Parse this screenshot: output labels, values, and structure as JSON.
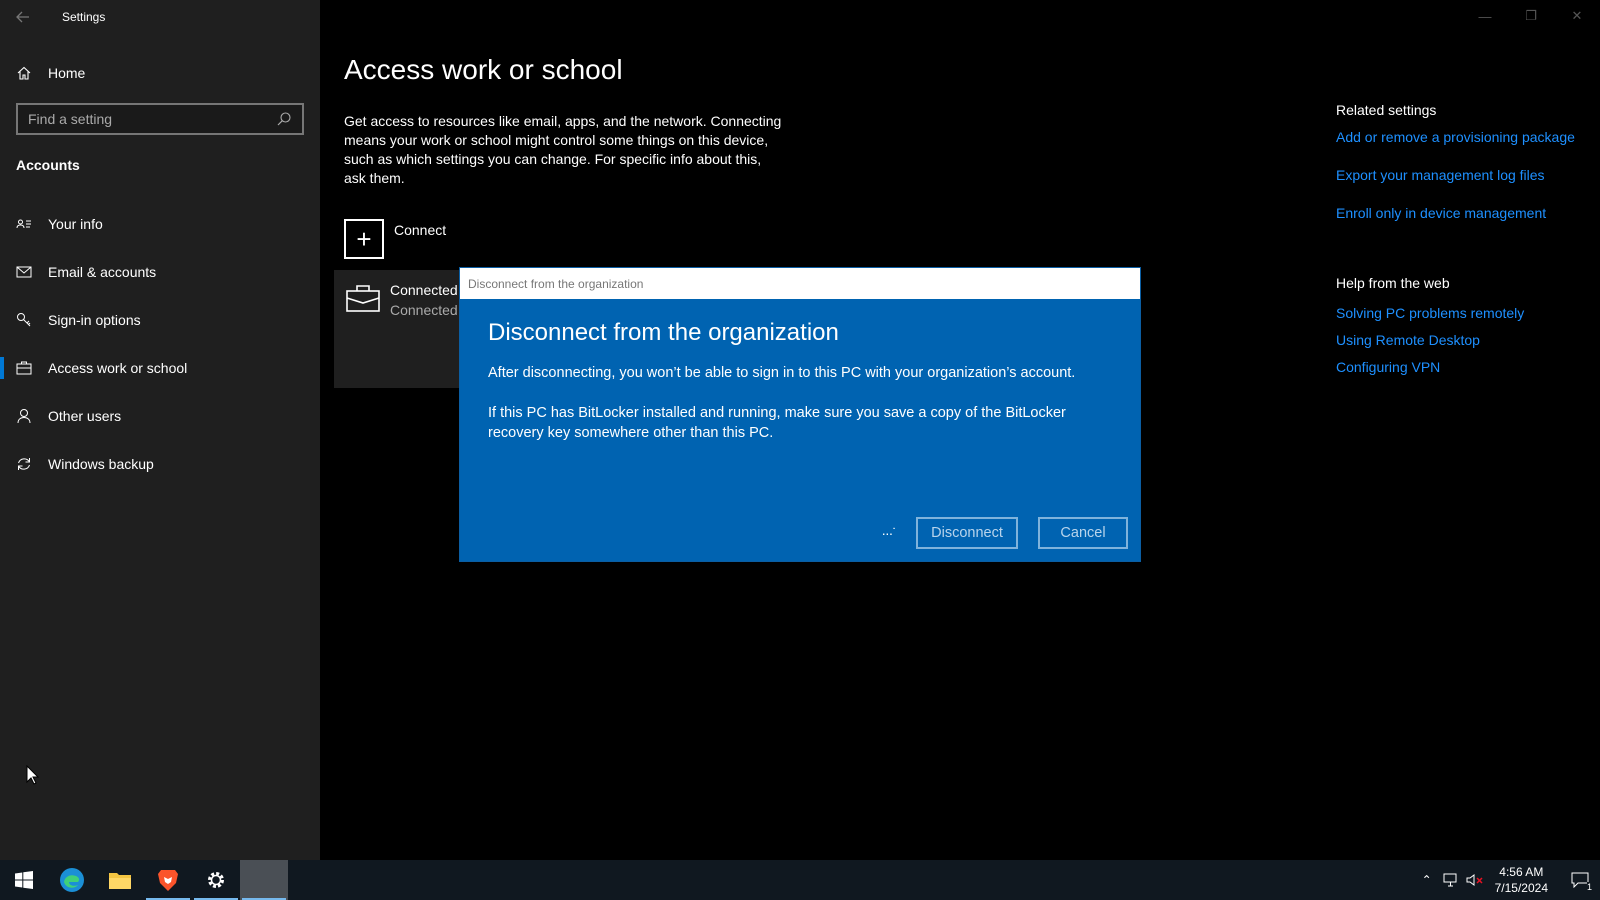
{
  "window": {
    "app_title": "Settings"
  },
  "sidebar": {
    "home_label": "Home",
    "search_placeholder": "Find a setting",
    "section_title": "Accounts",
    "items": [
      {
        "label": "Your info",
        "icon": "contact-card-icon"
      },
      {
        "label": "Email & accounts",
        "icon": "mail-icon"
      },
      {
        "label": "Sign-in options",
        "icon": "key-icon"
      },
      {
        "label": "Access work or school",
        "icon": "briefcase-icon",
        "active": true
      },
      {
        "label": "Other users",
        "icon": "person-icon"
      },
      {
        "label": "Windows backup",
        "icon": "sync-icon"
      }
    ]
  },
  "main": {
    "title": "Access work or school",
    "description": "Get access to resources like email, apps, and the network. Connecting means your work or school might control some things on this device, such as which settings you can change. For specific info about this, ask them.",
    "connect_label": "Connect",
    "account": {
      "title": "Connected",
      "status": "Connected"
    }
  },
  "related": {
    "heading": "Related settings",
    "links": [
      "Add or remove a provisioning package",
      "Export your management log files",
      "Enroll only in device management"
    ]
  },
  "help": {
    "heading": "Help from the web",
    "links": [
      "Solving PC problems remotely",
      "Using Remote Desktop",
      "Configuring VPN"
    ]
  },
  "dialog": {
    "window_title": "Disconnect from the organization",
    "heading": "Disconnect from the organization",
    "paragraph1": "After disconnecting, you won’t be able to sign in to this PC with your organization’s account.",
    "paragraph2": "If this PC has BitLocker installed and running, make sure you save a copy of the BitLocker recovery key somewhere other than this PC.",
    "disconnect_label": "Disconnect",
    "cancel_label": "Cancel"
  },
  "taskbar": {
    "time": "4:56 AM",
    "date": "7/15/2024",
    "notification_count": "1",
    "accent_color": "#0078d4"
  }
}
